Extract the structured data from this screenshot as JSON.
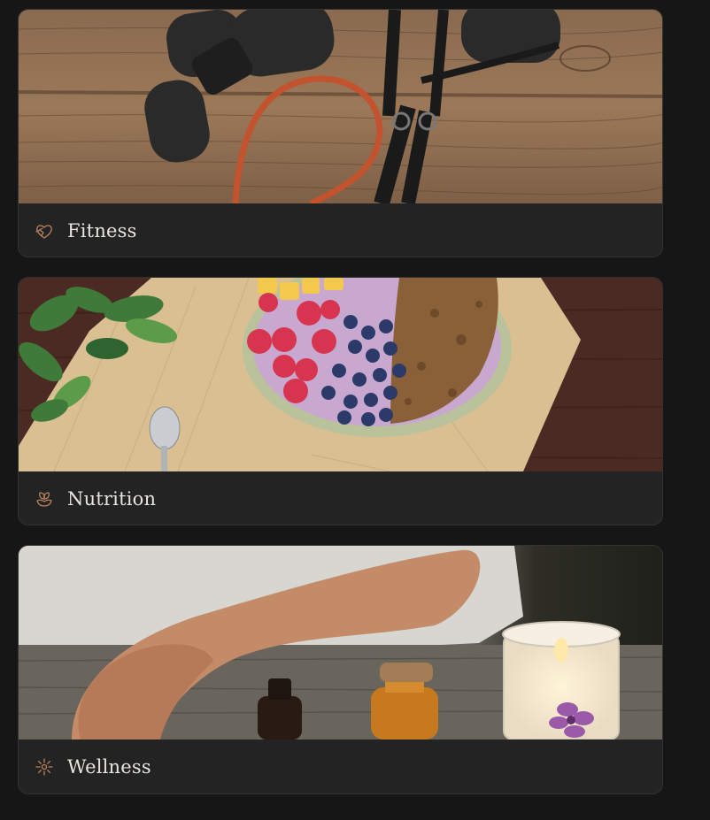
{
  "categories": [
    {
      "label": "Fitness",
      "icon": "heart-hands-icon",
      "image": "fitness-equipment-photo"
    },
    {
      "label": "Nutrition",
      "icon": "sprout-icon",
      "image": "smoothie-bowl-photo"
    },
    {
      "label": "Wellness",
      "icon": "sparkle-burst-icon",
      "image": "aromatherapy-candle-photo"
    }
  ],
  "colors": {
    "background": "#161616",
    "card": "#232323",
    "icon_accent": "#b8825e",
    "text": "#e8e4de"
  }
}
